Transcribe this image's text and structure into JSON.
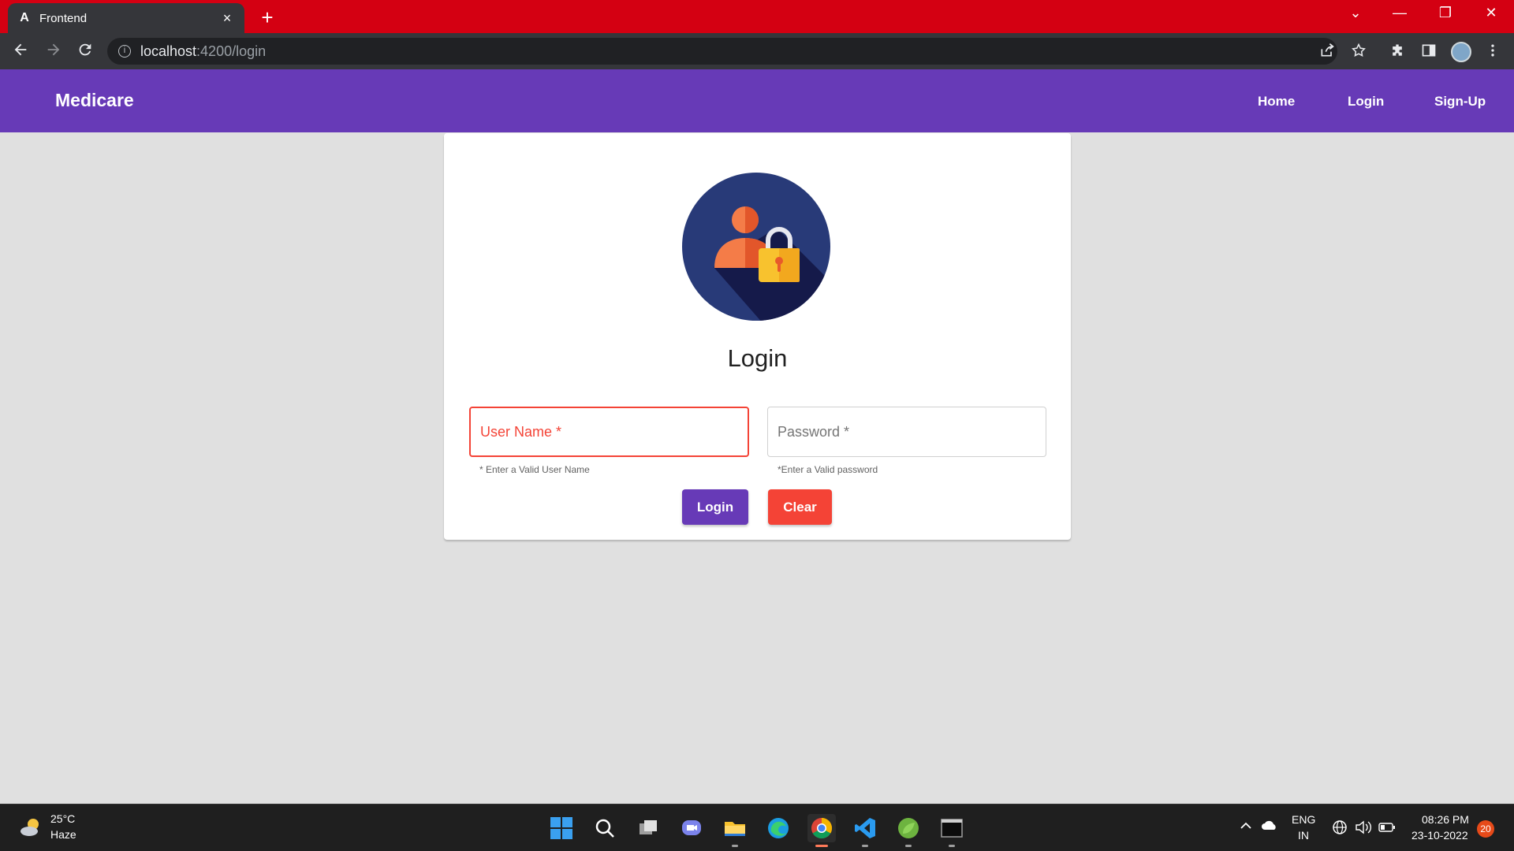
{
  "browser": {
    "tab_title": "Frontend",
    "tab_favicon": "A",
    "tab_close": "×",
    "new_tab": "+",
    "url_host": "localhost",
    "url_path": ":4200/login",
    "window_controls": [
      "⌄",
      "—",
      "❐",
      "✕"
    ]
  },
  "appbar": {
    "brand": "Medicare",
    "links": [
      "Home",
      "Login",
      "Sign-Up"
    ]
  },
  "login_card": {
    "icon": "user-lock-icon",
    "title": "Login",
    "username_placeholder": "User Name *",
    "username_hint": "* Enter a Valid User Name",
    "password_placeholder": "Password *",
    "password_hint": "*Enter a Valid password",
    "login_button": "Login",
    "clear_button": "Clear"
  },
  "taskbar": {
    "weather_temp": "25°C",
    "weather_desc": "Haze",
    "lang_top": "ENG",
    "lang_bottom": "IN",
    "time": "08:26 PM",
    "date": "23-10-2022",
    "notifications": "20"
  },
  "colors": {
    "primary": "#673ab7",
    "warn": "#f44336",
    "chrome_tabstrip": "#d40012"
  }
}
